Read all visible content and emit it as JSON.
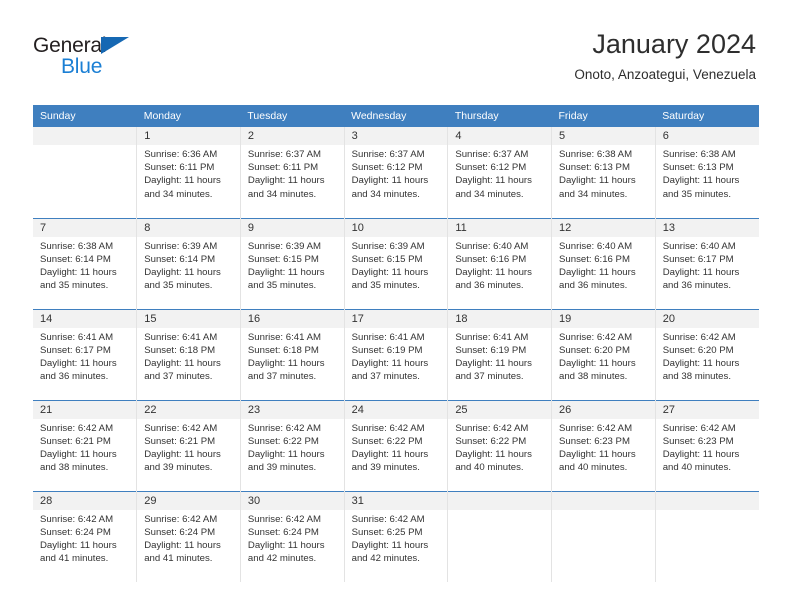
{
  "brand": {
    "name_part1": "General",
    "name_part2": "Blue",
    "accent_color": "#1b7fd4",
    "triangle_color": "#1668b3"
  },
  "header": {
    "title": "January 2024",
    "subtitle": "Onoto, Anzoategui, Venezuela"
  },
  "calendar": {
    "header_color": "#3f7fbf",
    "weekday_headers": [
      "Sunday",
      "Monday",
      "Tuesday",
      "Wednesday",
      "Thursday",
      "Friday",
      "Saturday"
    ],
    "weeks": [
      [
        {
          "day": "",
          "lines": []
        },
        {
          "day": "1",
          "lines": [
            "Sunrise: 6:36 AM",
            "Sunset: 6:11 PM",
            "Daylight: 11 hours",
            "and 34 minutes."
          ]
        },
        {
          "day": "2",
          "lines": [
            "Sunrise: 6:37 AM",
            "Sunset: 6:11 PM",
            "Daylight: 11 hours",
            "and 34 minutes."
          ]
        },
        {
          "day": "3",
          "lines": [
            "Sunrise: 6:37 AM",
            "Sunset: 6:12 PM",
            "Daylight: 11 hours",
            "and 34 minutes."
          ]
        },
        {
          "day": "4",
          "lines": [
            "Sunrise: 6:37 AM",
            "Sunset: 6:12 PM",
            "Daylight: 11 hours",
            "and 34 minutes."
          ]
        },
        {
          "day": "5",
          "lines": [
            "Sunrise: 6:38 AM",
            "Sunset: 6:13 PM",
            "Daylight: 11 hours",
            "and 34 minutes."
          ]
        },
        {
          "day": "6",
          "lines": [
            "Sunrise: 6:38 AM",
            "Sunset: 6:13 PM",
            "Daylight: 11 hours",
            "and 35 minutes."
          ]
        }
      ],
      [
        {
          "day": "7",
          "lines": [
            "Sunrise: 6:38 AM",
            "Sunset: 6:14 PM",
            "Daylight: 11 hours",
            "and 35 minutes."
          ]
        },
        {
          "day": "8",
          "lines": [
            "Sunrise: 6:39 AM",
            "Sunset: 6:14 PM",
            "Daylight: 11 hours",
            "and 35 minutes."
          ]
        },
        {
          "day": "9",
          "lines": [
            "Sunrise: 6:39 AM",
            "Sunset: 6:15 PM",
            "Daylight: 11 hours",
            "and 35 minutes."
          ]
        },
        {
          "day": "10",
          "lines": [
            "Sunrise: 6:39 AM",
            "Sunset: 6:15 PM",
            "Daylight: 11 hours",
            "and 35 minutes."
          ]
        },
        {
          "day": "11",
          "lines": [
            "Sunrise: 6:40 AM",
            "Sunset: 6:16 PM",
            "Daylight: 11 hours",
            "and 36 minutes."
          ]
        },
        {
          "day": "12",
          "lines": [
            "Sunrise: 6:40 AM",
            "Sunset: 6:16 PM",
            "Daylight: 11 hours",
            "and 36 minutes."
          ]
        },
        {
          "day": "13",
          "lines": [
            "Sunrise: 6:40 AM",
            "Sunset: 6:17 PM",
            "Daylight: 11 hours",
            "and 36 minutes."
          ]
        }
      ],
      [
        {
          "day": "14",
          "lines": [
            "Sunrise: 6:41 AM",
            "Sunset: 6:17 PM",
            "Daylight: 11 hours",
            "and 36 minutes."
          ]
        },
        {
          "day": "15",
          "lines": [
            "Sunrise: 6:41 AM",
            "Sunset: 6:18 PM",
            "Daylight: 11 hours",
            "and 37 minutes."
          ]
        },
        {
          "day": "16",
          "lines": [
            "Sunrise: 6:41 AM",
            "Sunset: 6:18 PM",
            "Daylight: 11 hours",
            "and 37 minutes."
          ]
        },
        {
          "day": "17",
          "lines": [
            "Sunrise: 6:41 AM",
            "Sunset: 6:19 PM",
            "Daylight: 11 hours",
            "and 37 minutes."
          ]
        },
        {
          "day": "18",
          "lines": [
            "Sunrise: 6:41 AM",
            "Sunset: 6:19 PM",
            "Daylight: 11 hours",
            "and 37 minutes."
          ]
        },
        {
          "day": "19",
          "lines": [
            "Sunrise: 6:42 AM",
            "Sunset: 6:20 PM",
            "Daylight: 11 hours",
            "and 38 minutes."
          ]
        },
        {
          "day": "20",
          "lines": [
            "Sunrise: 6:42 AM",
            "Sunset: 6:20 PM",
            "Daylight: 11 hours",
            "and 38 minutes."
          ]
        }
      ],
      [
        {
          "day": "21",
          "lines": [
            "Sunrise: 6:42 AM",
            "Sunset: 6:21 PM",
            "Daylight: 11 hours",
            "and 38 minutes."
          ]
        },
        {
          "day": "22",
          "lines": [
            "Sunrise: 6:42 AM",
            "Sunset: 6:21 PM",
            "Daylight: 11 hours",
            "and 39 minutes."
          ]
        },
        {
          "day": "23",
          "lines": [
            "Sunrise: 6:42 AM",
            "Sunset: 6:22 PM",
            "Daylight: 11 hours",
            "and 39 minutes."
          ]
        },
        {
          "day": "24",
          "lines": [
            "Sunrise: 6:42 AM",
            "Sunset: 6:22 PM",
            "Daylight: 11 hours",
            "and 39 minutes."
          ]
        },
        {
          "day": "25",
          "lines": [
            "Sunrise: 6:42 AM",
            "Sunset: 6:22 PM",
            "Daylight: 11 hours",
            "and 40 minutes."
          ]
        },
        {
          "day": "26",
          "lines": [
            "Sunrise: 6:42 AM",
            "Sunset: 6:23 PM",
            "Daylight: 11 hours",
            "and 40 minutes."
          ]
        },
        {
          "day": "27",
          "lines": [
            "Sunrise: 6:42 AM",
            "Sunset: 6:23 PM",
            "Daylight: 11 hours",
            "and 40 minutes."
          ]
        }
      ],
      [
        {
          "day": "28",
          "lines": [
            "Sunrise: 6:42 AM",
            "Sunset: 6:24 PM",
            "Daylight: 11 hours",
            "and 41 minutes."
          ]
        },
        {
          "day": "29",
          "lines": [
            "Sunrise: 6:42 AM",
            "Sunset: 6:24 PM",
            "Daylight: 11 hours",
            "and 41 minutes."
          ]
        },
        {
          "day": "30",
          "lines": [
            "Sunrise: 6:42 AM",
            "Sunset: 6:24 PM",
            "Daylight: 11 hours",
            "and 42 minutes."
          ]
        },
        {
          "day": "31",
          "lines": [
            "Sunrise: 6:42 AM",
            "Sunset: 6:25 PM",
            "Daylight: 11 hours",
            "and 42 minutes."
          ]
        },
        {
          "day": "",
          "lines": []
        },
        {
          "day": "",
          "lines": []
        },
        {
          "day": "",
          "lines": []
        }
      ]
    ]
  }
}
